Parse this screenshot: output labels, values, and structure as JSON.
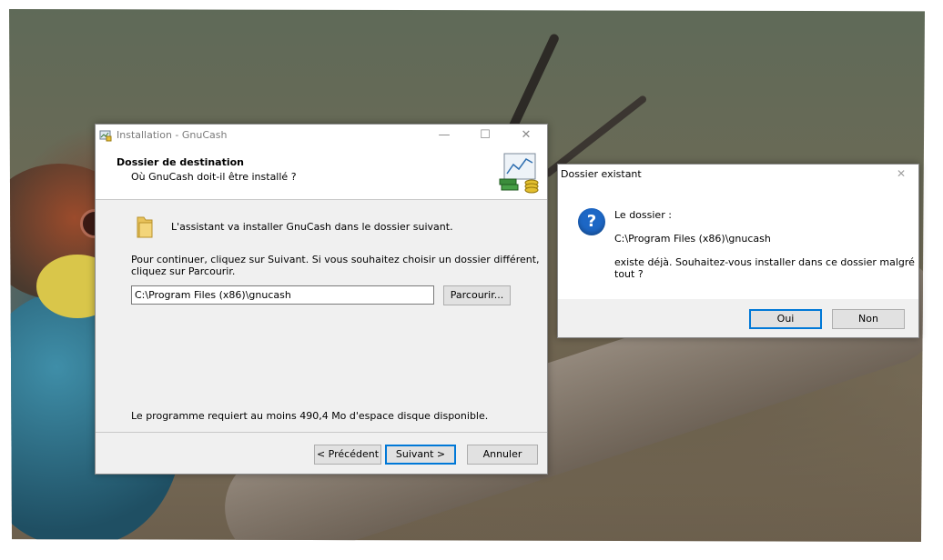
{
  "installer": {
    "title": "Installation - GnuCash",
    "header_title": "Dossier de destination",
    "header_subtitle": "Où GnuCash doit-il être installé ?",
    "intro": "L'assistant va installer GnuCash dans le dossier suivant.",
    "instructions_line1": "Pour continuer, cliquez sur Suivant. Si vous souhaitez choisir un dossier différent,",
    "instructions_line2": "cliquez sur Parcourir.",
    "path_value": "C:\\Program Files (x86)\\gnucash",
    "browse_label": "Parcourir...",
    "disk_space": "Le programme requiert au moins 490,4 Mo d'espace disque disponible.",
    "back_label": "< Précédent",
    "next_label": "Suivant >",
    "cancel_label": "Annuler",
    "minimize_glyph": "—",
    "maximize_glyph": "☐",
    "close_glyph": "✕"
  },
  "message_box": {
    "title": "Dossier existant",
    "line1": "Le dossier :",
    "path": "C:\\Program Files (x86)\\gnucash",
    "line3a": "existe déjà. Souhaitez-vous installer dans ce dossier malgré",
    "line3b": "tout ?",
    "yes_label": "Oui",
    "no_label": "Non",
    "question_glyph": "?",
    "close_glyph": "✕"
  },
  "colors": {
    "accent": "#0078d7",
    "dialog_bg": "#f0f0f0",
    "question_icon": "#1d67c5"
  },
  "icons": {
    "installer_app": "gnucash-installer-icon",
    "header_graphic": "chart-money-icon",
    "folder": "folder-icon",
    "question": "question-icon"
  }
}
